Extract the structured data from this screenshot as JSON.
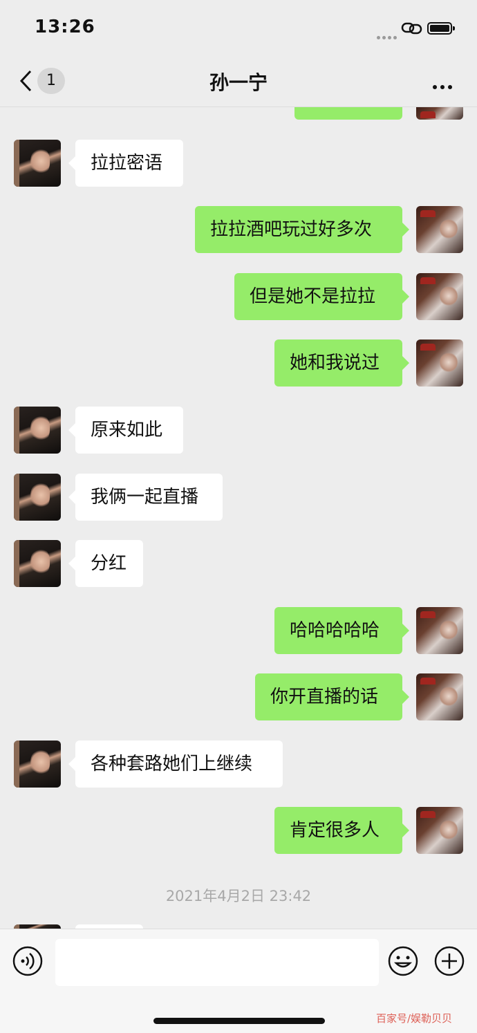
{
  "status_bar": {
    "time": "13:26"
  },
  "nav": {
    "unread_count": "1",
    "title": "孙一宁"
  },
  "messages": [
    {
      "side": "in",
      "text": "拉拉密语"
    },
    {
      "side": "out",
      "text": "拉拉酒吧玩过好多次"
    },
    {
      "side": "out",
      "text": "但是她不是拉拉"
    },
    {
      "side": "out",
      "text": "她和我说过"
    },
    {
      "side": "in",
      "text": "原来如此"
    },
    {
      "side": "in",
      "text": "我俩一起直播"
    },
    {
      "side": "in",
      "text": "分红"
    },
    {
      "side": "out",
      "text": "哈哈哈哈哈"
    },
    {
      "side": "out",
      "text": "你开直播的话"
    },
    {
      "side": "in",
      "text": "各种套路她们上继续"
    },
    {
      "side": "out",
      "text": "肯定很多人"
    }
  ],
  "timestamp": "2021年4月2日 23:42",
  "input_bar": {
    "placeholder": ""
  },
  "watermark": "百家号/娱勒贝贝",
  "colors": {
    "background": "#ededed",
    "bubble_out": "#95ec69",
    "bubble_in": "#ffffff"
  },
  "icons": [
    "back-icon",
    "more-icon",
    "voice-icon",
    "emoji-icon",
    "plus-icon"
  ]
}
